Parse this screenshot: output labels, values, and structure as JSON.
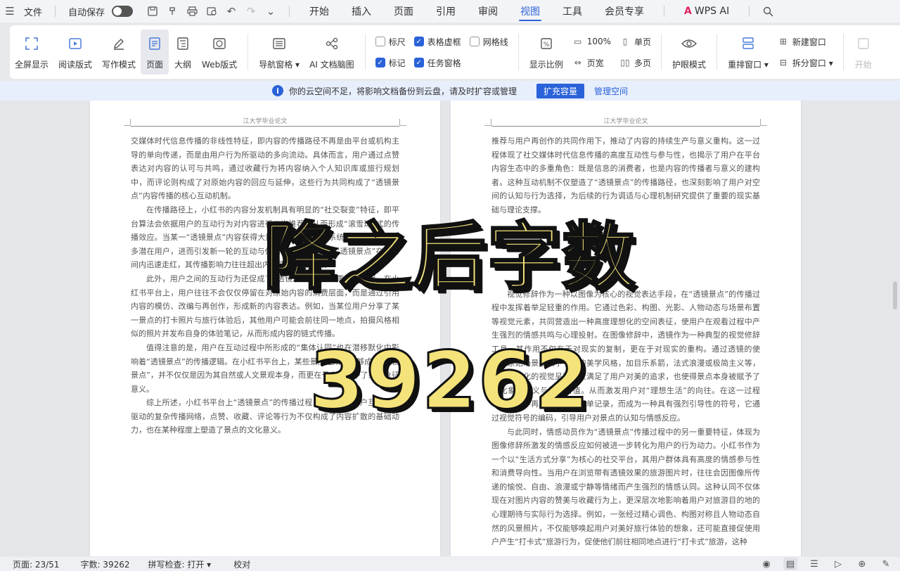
{
  "menubar": {
    "file": "文件",
    "autosave": "自动保存",
    "tabs": [
      "开始",
      "插入",
      "页面",
      "引用",
      "审阅",
      "视图",
      "工具",
      "会员专享"
    ],
    "active_tab": "视图",
    "wps_ai": "WPS AI"
  },
  "ribbon": {
    "view_modes": [
      "全屏显示",
      "阅读版式",
      "写作模式",
      "页面",
      "大纲",
      "Web版式"
    ],
    "nav_pane": "导航窗格",
    "ai_mindmap": "AI 文档脑图",
    "checkboxes": {
      "ruler": "标尺",
      "table_gridlines": "表格虚框",
      "gridlines": "网格线",
      "marks": "标记",
      "task_pane": "任务窗格"
    },
    "display_ratio": "显示比例",
    "zoom_100": "100%",
    "page_width": "页宽",
    "single_page": "单页",
    "multi_page": "多页",
    "eye_mode": "护眼模式",
    "rearrange": "重排窗口",
    "new_window": "新建窗口",
    "split_window": "拆分窗口",
    "more": "开始"
  },
  "notice": {
    "message": "你的云空间不足，将影响文档备份到云盘，请及时扩容或管理",
    "expand": "扩充容量",
    "manage": "管理空间"
  },
  "doc": {
    "header_left": "江大学毕业论文",
    "header_right": "江大学毕业论文",
    "left_paragraphs": [
      "交媒体时代信息传播的非线性特征，即内容的传播路径不再是由平台或机构主导的单向传递，而是由用户行为所驱动的多向流动。具体而言，用户通过点赞表达对内容的认可与共鸣，通过收藏行为将内容纳入个人知识库或旅行规划中，而评论则构成了对原始内容的回应与延伸，这些行为共同构成了“透镜景点”内容传播的核心互动机制。",
      "在传播路径上，小红书的内容分发机制具有明显的“社交裂变”特征，即平台算法会依据用户的互动行为对内容进行二次推荐，从而形成“滚雪球”式的传播效应。当某一“透镜景点”内容获得大量点赞与收藏时，系统会将其推送至更多潜在用户，进而引发新一轮的互动与传播。这种机制使得“透镜景点”在短时间内迅速走红，其传播影响力往往超出内容原创者的预期。",
      "此外，用户之间的互动行为还促成了“透镜景点”内容的再生产过程。在小红书平台上，用户往往不会仅仅停留在对原始内容的消费层面，而是通过引用内容的模仿、改编与再创作，形成新的内容表达。例如，当某位用户分享了某一景点的打卡照片与旅行体验后，其他用户可能会前往同一地点，拍摄风格相似的照片并发布自身的体验笔记，从而形成内容的链式传播。",
      "值得注意的是，用户在互动过程中所形成的“集体认同”也在潜移默化中影响着“透镜景点”的传播逻辑。在小红书平台上，某些景点之所以能够成为“透镜景点”，并不仅仅是因为其自然或人文景观本身，而更在于它被赋予了某种象征意义。",
      "综上所述，小红书平台上“透镜景点”的传播过程，是一个由用户互动行为驱动的复杂传播网络，点赞、收藏、评论等行为不仅构成了内容扩散的基础动力，也在某种程度上塑造了景点的文化意义。"
    ],
    "right_paragraphs": [
      "推荐与用户再创作的共同作用下，推动了内容的持续生产与意义重构。这一过程体现了社交媒体时代信息传播的高度互动性与参与性，也揭示了用户在平台内容生态中的多重角色：既是信息的消费者，也是内容的传播者与意义的建构者。这种互动机制不仅塑造了“透镜景点”的传播路径，也深刻影响了用户对空间的认知与行为选择，为后续的行为调适与心理机制研究提供了重要的现实基础与理论支撑。",
      "视觉修辞作为一种以图像为核心的视觉表达手段，在“透镜景点”的传播过程中发挥着举足轻重的作用。它通过色彩、构图、光影、人物动态与场景布置等视觉元素，共同营造出一种高度理想化的空间表征，使用户在观看过程中产生强烈的情感共鸣与心理投射。在图像修辞中，透镜作为一种典型的视觉修辞工具，其作用不仅在于对现实的复制，更在于对现实的重构。通过透镜的使用，原始场景被赋予了新的美学风格，加目乐系箭，法式浪漫或极简主义等，这些风格化的视觉呈现不仅满足了用户对美的追求，也使得景点本身被赋予了文化象征意义与情感价值。从而激发用户对“理想生活”的向往。在这一过程中，图像不再是对现实的简单记录，而成为一种具有强烈引导性的符号，它通过视觉符号的编码，引导用户对景点的认知与情感反应。",
      "与此同时，情感动员作为“透镜景点”传播过程中的另一重要特征，体现为图像修辞所激发的情感反应如何被进一步转化为用户的行为动力。小红书作为一个以“生活方式分享”为核心的社交平台，其用户群体具有高度的情感参与性和消费导向性。当用户在浏览带有透镜效果的旅游图片时，往往会因图像所传递的愉悦、自由、浪漫或宁静等情绪而产生强烈的情感认同。这种认同不仅体现在对图片内容的赞美与收藏行为上，更深层次地影响着用户对旅游目的地的心理期待与实际行为选择。例如，一张经过精心调色、构图对称且人物动态自然的风景照片，不仅能够唤起用户对美好旅行体验的想象，还可能直接促使用户产生“打卡式”旅游行为，促使他们前往相同地点进行“打卡式”旅游，这种"
    ]
  },
  "overlay": {
    "line1": "降之后字数",
    "line2": "39262"
  },
  "status": {
    "page": "页面: 23/51",
    "words": "字数: 39262",
    "spellcheck": "拼写检查: 打开",
    "proof": "校对"
  }
}
